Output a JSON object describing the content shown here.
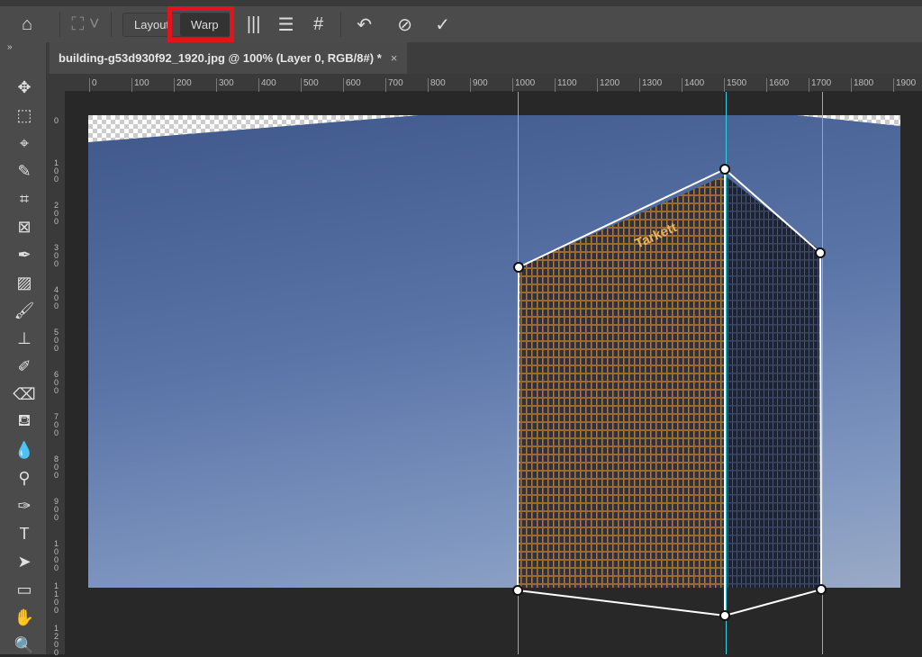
{
  "options_bar": {
    "icons": [
      "home-icon",
      "warp-mode-icon",
      "split-vertical-icon",
      "split-horizontal-icon",
      "split-cross-icon",
      "reset-icon",
      "cancel-icon",
      "commit-icon"
    ],
    "layout_label": "Layout",
    "warp_label": "Warp",
    "selected": "Warp"
  },
  "document_tab": {
    "title": "building-g53d930f92_1920.jpg @ 100% (Layer 0, RGB/8#) *",
    "close": "×"
  },
  "toolbar": {
    "collapse": "»",
    "tools": [
      {
        "name": "move-tool",
        "glyph": "✥"
      },
      {
        "name": "marquee-tool",
        "glyph": "⬚"
      },
      {
        "name": "lasso-tool",
        "glyph": "⌖"
      },
      {
        "name": "quick-selection-tool",
        "glyph": "✎"
      },
      {
        "name": "crop-tool",
        "glyph": "⌗"
      },
      {
        "name": "frame-tool",
        "glyph": "⊠"
      },
      {
        "name": "eyedropper-tool",
        "glyph": "✒"
      },
      {
        "name": "healing-brush-tool",
        "glyph": "▨"
      },
      {
        "name": "brush-tool",
        "glyph": "🖌"
      },
      {
        "name": "clone-stamp-tool",
        "glyph": "⊥"
      },
      {
        "name": "history-brush-tool",
        "glyph": "✐"
      },
      {
        "name": "eraser-tool",
        "glyph": "⌫"
      },
      {
        "name": "paint-bucket-tool",
        "glyph": "⛾"
      },
      {
        "name": "blur-tool",
        "glyph": "💧"
      },
      {
        "name": "dodge-tool",
        "glyph": "⚲"
      },
      {
        "name": "pen-tool",
        "glyph": "✑"
      },
      {
        "name": "type-tool",
        "glyph": "T"
      },
      {
        "name": "path-selection-tool",
        "glyph": "➤"
      },
      {
        "name": "rectangle-tool",
        "glyph": "▭"
      },
      {
        "name": "hand-tool",
        "glyph": "✋"
      },
      {
        "name": "zoom-tool",
        "glyph": "🔍"
      }
    ]
  },
  "ruler_top": [
    "0",
    "100",
    "200",
    "300",
    "400",
    "500",
    "600",
    "700",
    "800",
    "900",
    "1000",
    "1100",
    "1200",
    "1300",
    "1400",
    "1500",
    "1600",
    "1700",
    "1800",
    "1900"
  ],
  "ruler_left": [
    "0",
    "100",
    "200",
    "300",
    "400",
    "500",
    "600",
    "700",
    "800",
    "900",
    "1000",
    "1100",
    "1200"
  ],
  "image": {
    "sign_text": "Tarkett",
    "colors": {
      "guide": "#34d2e0",
      "highlight": "#e0141a",
      "sky": "#5a74a8"
    }
  }
}
